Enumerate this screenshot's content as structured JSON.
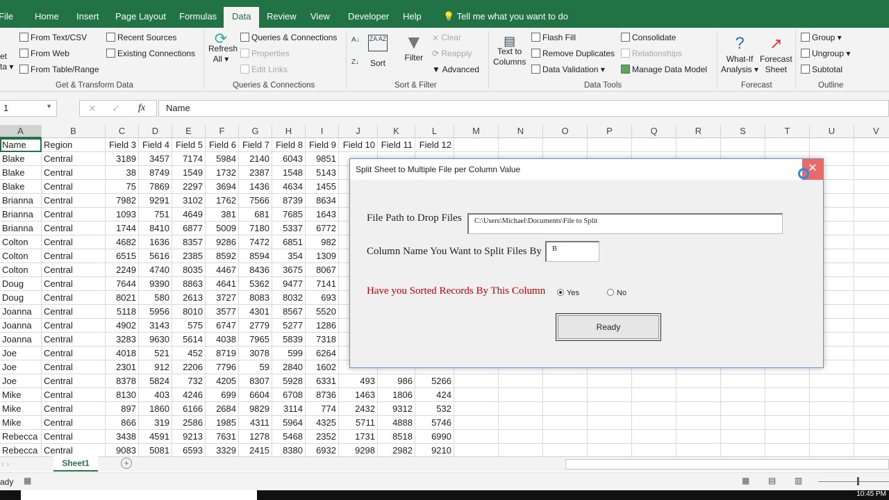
{
  "tabs": [
    "File",
    "Home",
    "Insert",
    "Page Layout",
    "Formulas",
    "Data",
    "Review",
    "View",
    "Developer",
    "Help"
  ],
  "tell_me": "Tell me what you want to do",
  "ribbon": {
    "get_data": [
      "et",
      "ta ▾"
    ],
    "from_text": "From Text/CSV",
    "from_web": "From Web",
    "from_table": "From Table/Range",
    "recent_sources": "Recent Sources",
    "existing_connections": "Existing Connections",
    "group_get": "Get & Transform Data",
    "refresh_all": [
      "Refresh",
      "All ▾"
    ],
    "queries_connections": "Queries & Connections",
    "properties": "Properties",
    "edit_links": "Edit Links",
    "group_queries": "Queries & Connections",
    "sort": "Sort",
    "filter": "Filter",
    "clear": "Clear",
    "reapply": "Reapply",
    "advanced": "Advanced",
    "group_sort": "Sort & Filter",
    "text_to_columns": [
      "Text to",
      "Columns"
    ],
    "flash_fill": "Flash Fill",
    "remove_duplicates": "Remove Duplicates",
    "data_validation": "Data Validation  ▾",
    "consolidate": "Consolidate",
    "relationships": "Relationships",
    "manage_data_model": "Manage Data Model",
    "group_tools": "Data Tools",
    "what_if": [
      "What-If",
      "Analysis ▾"
    ],
    "forecast_sheet": [
      "Forecast",
      "Sheet"
    ],
    "group_forecast": "Forecast",
    "group": "Group  ▾",
    "ungroup": "Ungroup  ▾",
    "subtotal": "Subtotal",
    "group_outline": "Outline"
  },
  "name_box": "1",
  "formula": "Name",
  "columns": [
    "A",
    "B",
    "C",
    "D",
    "E",
    "F",
    "G",
    "H",
    "I",
    "J",
    "K",
    "L",
    "M",
    "N",
    "O",
    "P",
    "Q",
    "R",
    "S",
    "T",
    "U",
    "V"
  ],
  "header_row": [
    "Name",
    "Region",
    "Field 3",
    "Field 4",
    "Field 5",
    "Field 6",
    "Field 7",
    "Field 8",
    "Field 9",
    "Field 10",
    "Field 11",
    "Field 12"
  ],
  "rows": [
    [
      "Blake",
      "Central",
      "3189",
      "3457",
      "7174",
      "5984",
      "2140",
      "6043",
      "9851",
      "",
      "",
      ""
    ],
    [
      "Blake",
      "Central",
      "38",
      "8749",
      "1549",
      "1732",
      "2387",
      "1548",
      "5143",
      "",
      "",
      ""
    ],
    [
      "Blake",
      "Central",
      "75",
      "7869",
      "2297",
      "3694",
      "1436",
      "4634",
      "1455",
      "",
      "",
      ""
    ],
    [
      "Brianna",
      "Central",
      "7982",
      "9291",
      "3102",
      "1762",
      "7566",
      "8739",
      "8634",
      "",
      "",
      ""
    ],
    [
      "Brianna",
      "Central",
      "1093",
      "751",
      "4649",
      "381",
      "681",
      "7685",
      "1643",
      "",
      "",
      ""
    ],
    [
      "Brianna",
      "Central",
      "1744",
      "8410",
      "6877",
      "5009",
      "7180",
      "5337",
      "6772",
      "",
      "",
      ""
    ],
    [
      "Colton",
      "Central",
      "4682",
      "1636",
      "8357",
      "9286",
      "7472",
      "6851",
      "982",
      "",
      "",
      ""
    ],
    [
      "Colton",
      "Central",
      "6515",
      "5616",
      "2385",
      "8592",
      "8594",
      "354",
      "1309",
      "",
      "",
      ""
    ],
    [
      "Colton",
      "Central",
      "2249",
      "4740",
      "8035",
      "4467",
      "8436",
      "3675",
      "8067",
      "",
      "",
      ""
    ],
    [
      "Doug",
      "Central",
      "7644",
      "9390",
      "8863",
      "4641",
      "5362",
      "9477",
      "7141",
      "",
      "",
      ""
    ],
    [
      "Doug",
      "Central",
      "8021",
      "580",
      "2613",
      "3727",
      "8083",
      "8032",
      "693",
      "",
      "",
      ""
    ],
    [
      "Joanna",
      "Central",
      "5118",
      "5956",
      "8010",
      "3577",
      "4301",
      "8567",
      "5520",
      "",
      "",
      ""
    ],
    [
      "Joanna",
      "Central",
      "4902",
      "3143",
      "575",
      "6747",
      "2779",
      "5277",
      "1286",
      "",
      "",
      ""
    ],
    [
      "Joanna",
      "Central",
      "3283",
      "9630",
      "5614",
      "4038",
      "7965",
      "5839",
      "7318",
      "",
      "",
      ""
    ],
    [
      "Joe",
      "Central",
      "4018",
      "521",
      "452",
      "8719",
      "3078",
      "599",
      "6264",
      "",
      "",
      ""
    ],
    [
      "Joe",
      "Central",
      "2301",
      "912",
      "2206",
      "7796",
      "59",
      "2840",
      "1602",
      "",
      "",
      ""
    ],
    [
      "Joe",
      "Central",
      "8378",
      "5824",
      "732",
      "4205",
      "8307",
      "5928",
      "6331",
      "493",
      "986",
      "5266"
    ],
    [
      "Mike",
      "Central",
      "8130",
      "403",
      "4246",
      "699",
      "6604",
      "6708",
      "8736",
      "1463",
      "1806",
      "424"
    ],
    [
      "Mike",
      "Central",
      "897",
      "1860",
      "6166",
      "2684",
      "9829",
      "3114",
      "774",
      "2432",
      "9312",
      "532"
    ],
    [
      "Mike",
      "Central",
      "866",
      "319",
      "2586",
      "1985",
      "4311",
      "5964",
      "4325",
      "5711",
      "4888",
      "5746"
    ],
    [
      "Rebecca",
      "Central",
      "3438",
      "4591",
      "9213",
      "7631",
      "1278",
      "5468",
      "2352",
      "1731",
      "8518",
      "6990"
    ],
    [
      "Rebecca",
      "Central",
      "9083",
      "5081",
      "6593",
      "3329",
      "2415",
      "8380",
      "6932",
      "9298",
      "2982",
      "9210"
    ]
  ],
  "dialog": {
    "title": "Split Sheet to Multiple File per Column Value",
    "file_path_label": "File Path to Drop Files",
    "file_path_value": "C:\\Users\\Michael\\Documents\\File to Split",
    "column_label": "Column Name You Want to Split Files By",
    "column_value": "B",
    "sorted_label": "Have you Sorted Records By This Column",
    "yes": "Yes",
    "no": "No",
    "selected": "Yes",
    "ready": "Ready",
    "close": "✕"
  },
  "sheet_tab": "Sheet1",
  "status": "ady",
  "clock": "10:45 PM",
  "colors": {
    "excel_green": "#217346",
    "sorted_label": "#c00000",
    "close": "#e86a6a"
  }
}
